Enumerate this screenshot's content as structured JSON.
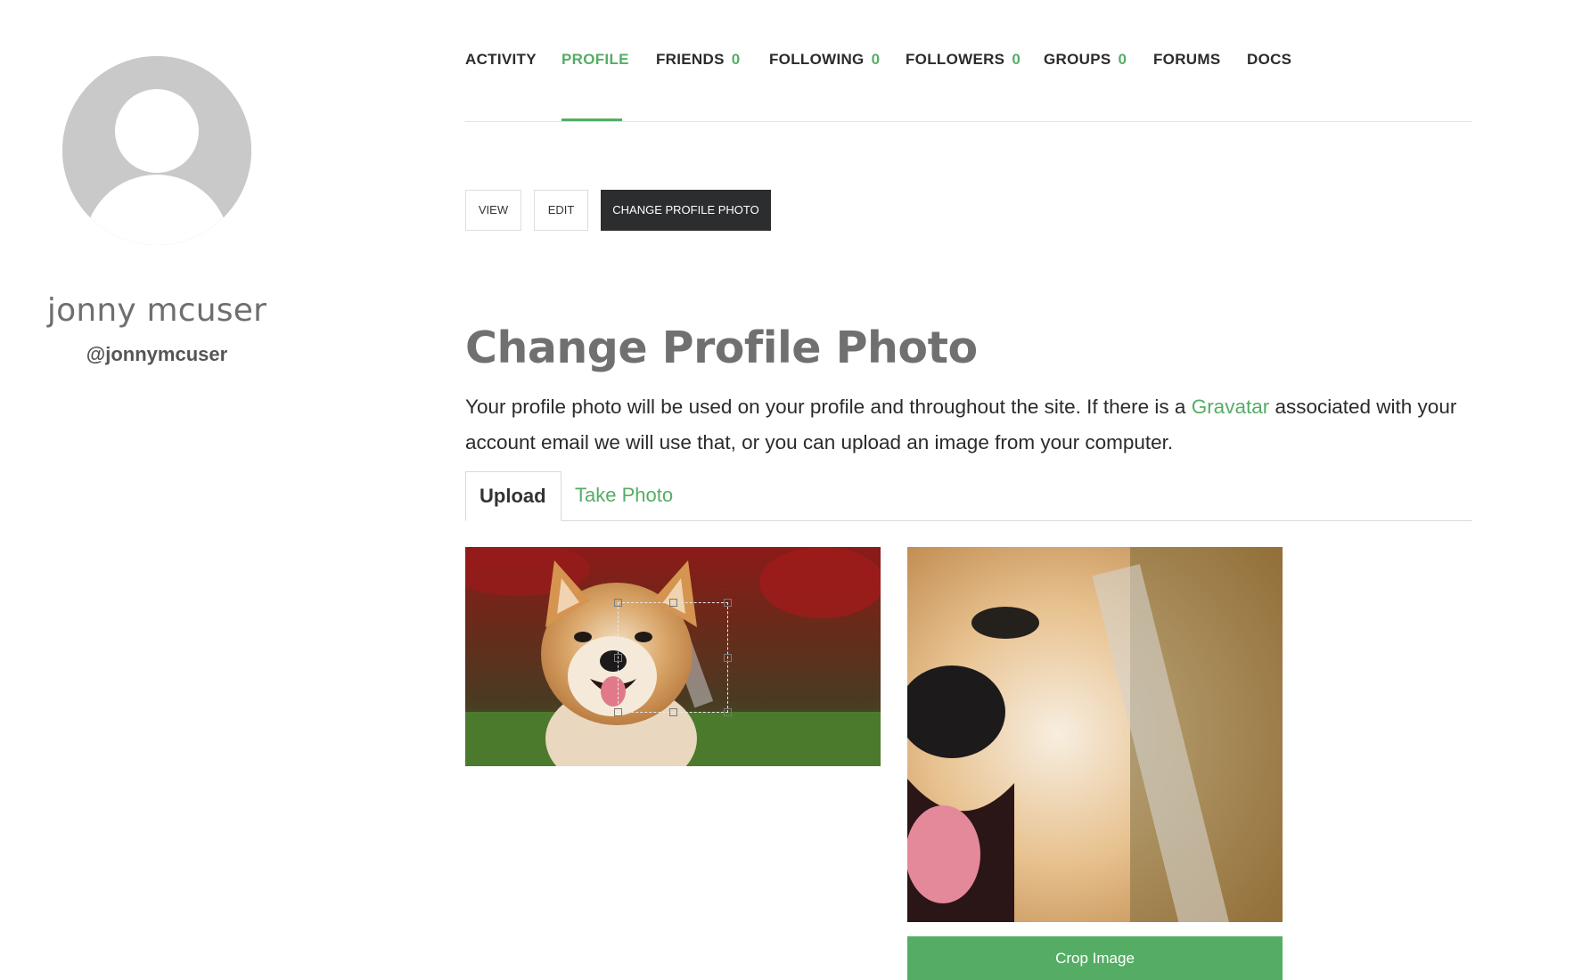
{
  "profile": {
    "display_name": "jonny mcuser",
    "handle": "@jonnymcuser"
  },
  "primary_nav": {
    "items": [
      {
        "label": "ACTIVITY",
        "count": null
      },
      {
        "label": "PROFILE",
        "count": null,
        "active": true
      },
      {
        "label": "FRIENDS",
        "count": "0"
      },
      {
        "label": "FOLLOWING",
        "count": "0"
      },
      {
        "label": "FOLLOWERS",
        "count": "0"
      },
      {
        "label": "GROUPS",
        "count": "0"
      },
      {
        "label": "FORUMS",
        "count": null
      },
      {
        "label": "DOCS",
        "count": null
      }
    ]
  },
  "sub_nav": {
    "view": "VIEW",
    "edit": "EDIT",
    "change_photo": "CHANGE PROFILE PHOTO"
  },
  "content": {
    "title": "Change Profile Photo",
    "intro_before_link": "Your profile photo will be used on your profile and throughout the site. If there is a ",
    "intro_link": "Gravatar",
    "intro_after_link": " associated with your account email we will use that, or you can upload an image from your computer.",
    "tabs": {
      "upload": "Upload",
      "take_photo": "Take Photo"
    },
    "crop_button": "Crop Image"
  },
  "colors": {
    "accent": "#55ad65",
    "dark_button": "#2b2d2f",
    "title_gray": "#707070"
  }
}
